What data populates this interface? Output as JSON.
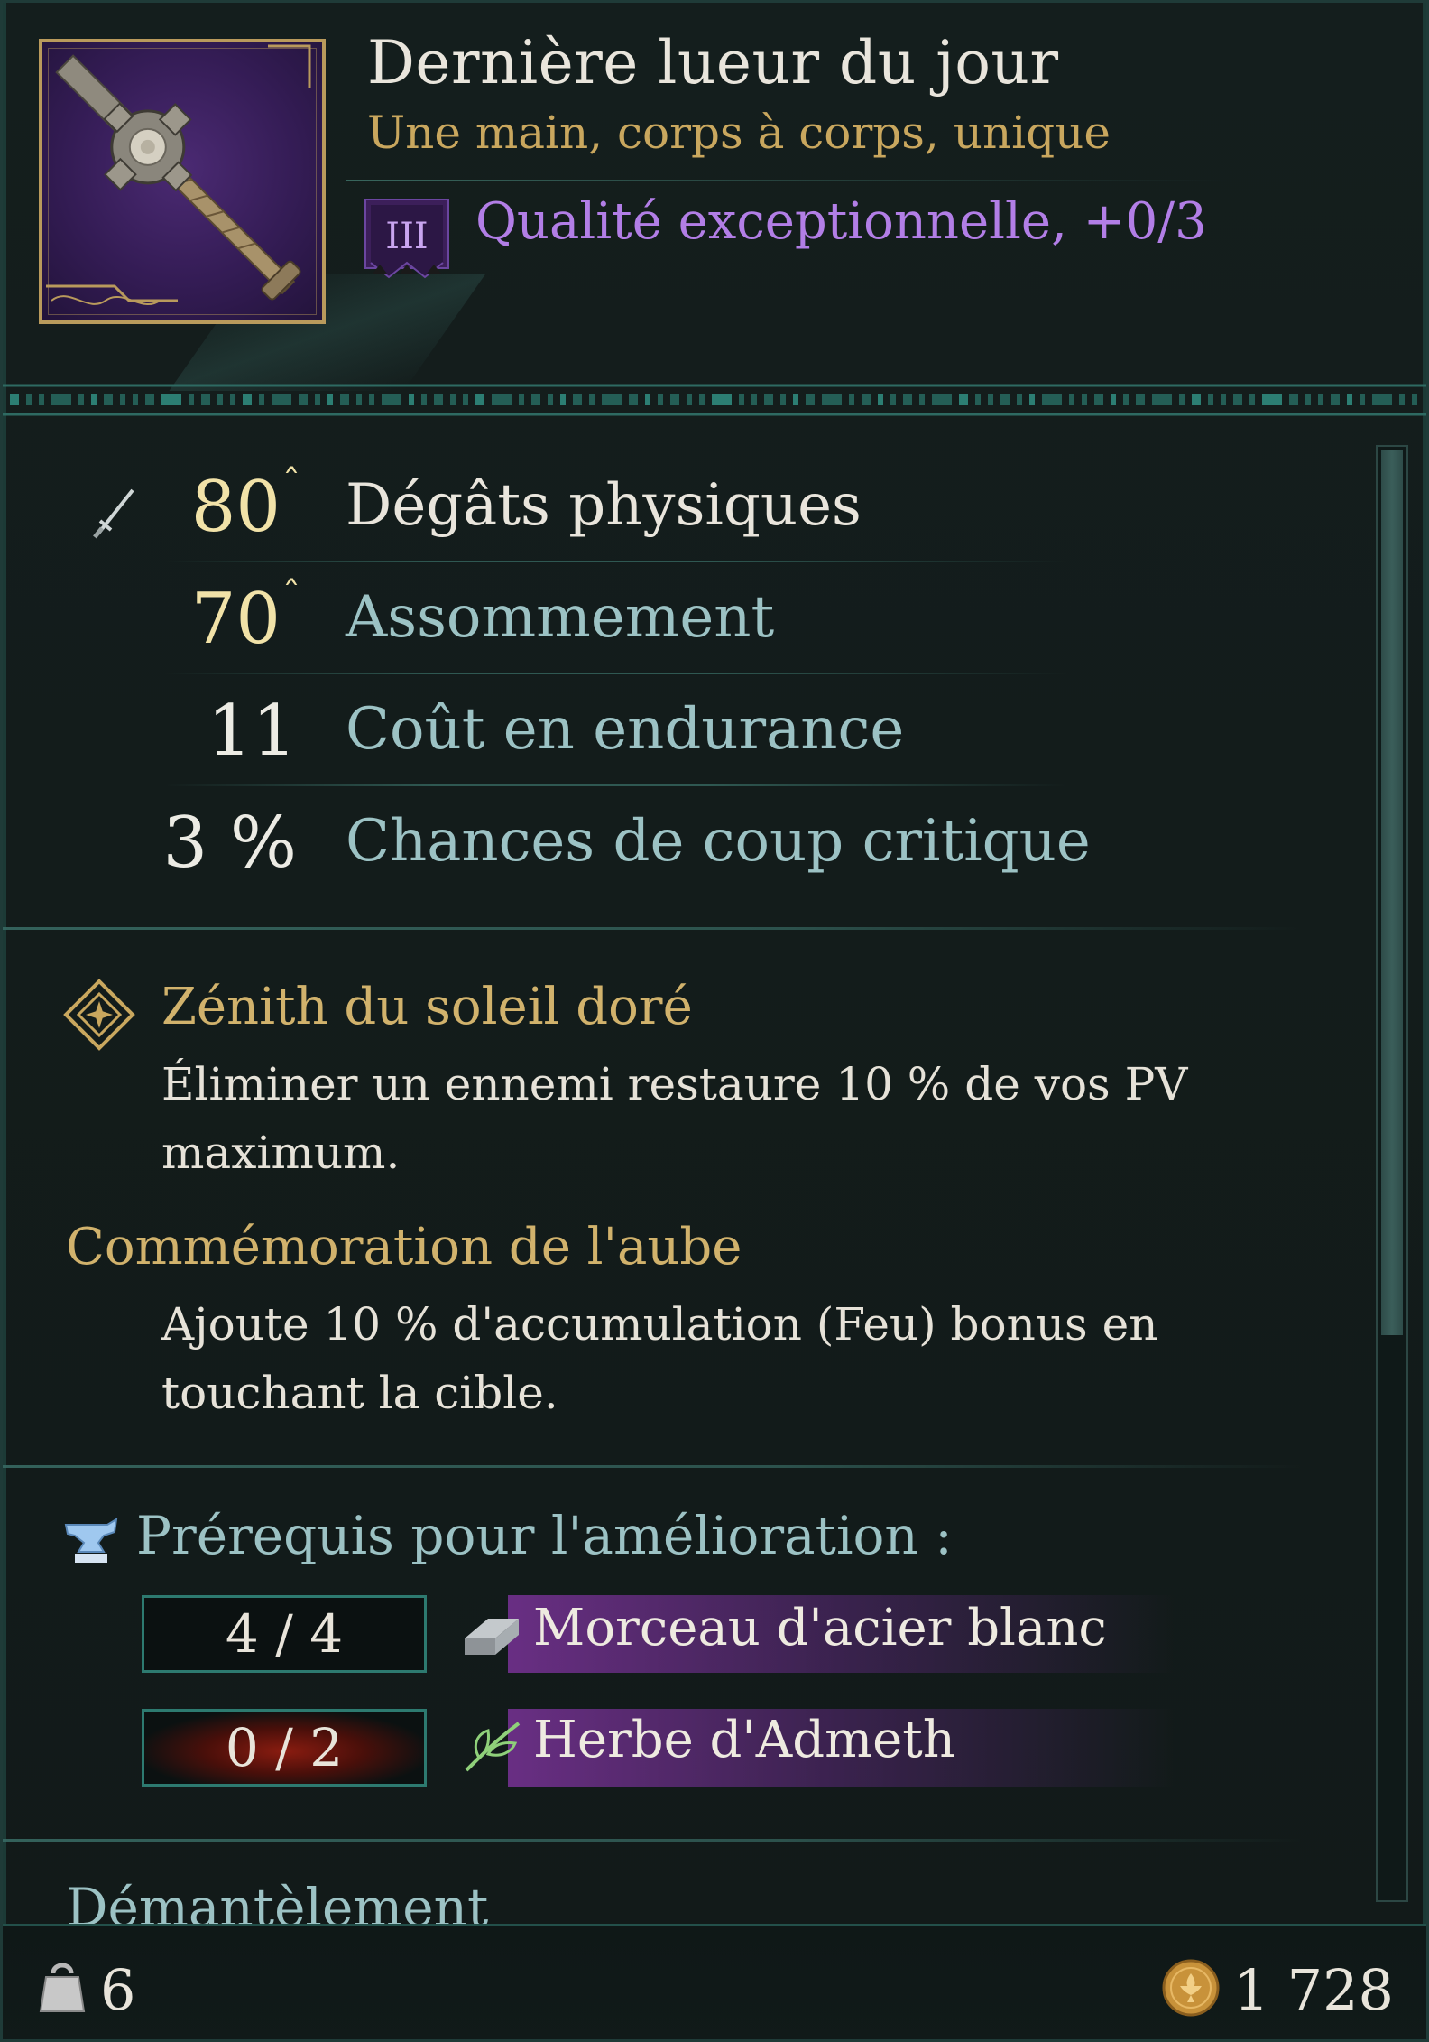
{
  "item": {
    "name": "Dernière lueur du jour",
    "type_line": "Une main, corps à corps, unique",
    "quality_tier": "III",
    "quality_text": "Qualité exceptionnelle, +0/3",
    "image_icon": "mace-weapon-icon",
    "frame_color": "#b99a5c",
    "quality_color": "#b27ee6"
  },
  "stats": [
    {
      "value": "80",
      "upgrade_marker": "ˆ",
      "label": "Dégâts physiques",
      "icon": "sword-icon",
      "value_color": "#f1e2a8",
      "label_color": "#e9e5dc"
    },
    {
      "value": "70",
      "upgrade_marker": "ˆ",
      "label": "Assommement",
      "value_color": "#f1e2a8",
      "label_color": "#9cc2c4"
    },
    {
      "value": "11",
      "label": "Coût en endurance",
      "value_color": "#ecebe4",
      "label_color": "#9cc2c4"
    },
    {
      "value": "3 %",
      "label": "Chances de coup critique",
      "value_color": "#ecebe4",
      "label_color": "#9cc2c4"
    }
  ],
  "perks": [
    {
      "title": "Zénith du soleil doré",
      "icon": "diamond-rune-icon",
      "description": "Éliminer un ennemi restaure 10 % de vos PV maximum."
    },
    {
      "title": "Commémoration de l'aube",
      "description": "Ajoute 10 % d'accumulation (Feu) bonus en touchant la cible."
    }
  ],
  "upgrade": {
    "title": "Prérequis pour l'amélioration :",
    "icon": "anvil-icon",
    "materials": [
      {
        "count": "4 / 4",
        "name": "Morceau d'acier blanc",
        "icon": "steel-ingot-icon",
        "sufficient": true
      },
      {
        "count": "0 / 2",
        "name": "Herbe d'Admeth",
        "icon": "herb-leaf-icon",
        "sufficient": false
      }
    ]
  },
  "dismantle_label": "Démantèlement",
  "footer": {
    "weight_icon": "weight-icon",
    "weight": "6",
    "currency_icon": "coin-icon",
    "value": "1 728"
  }
}
